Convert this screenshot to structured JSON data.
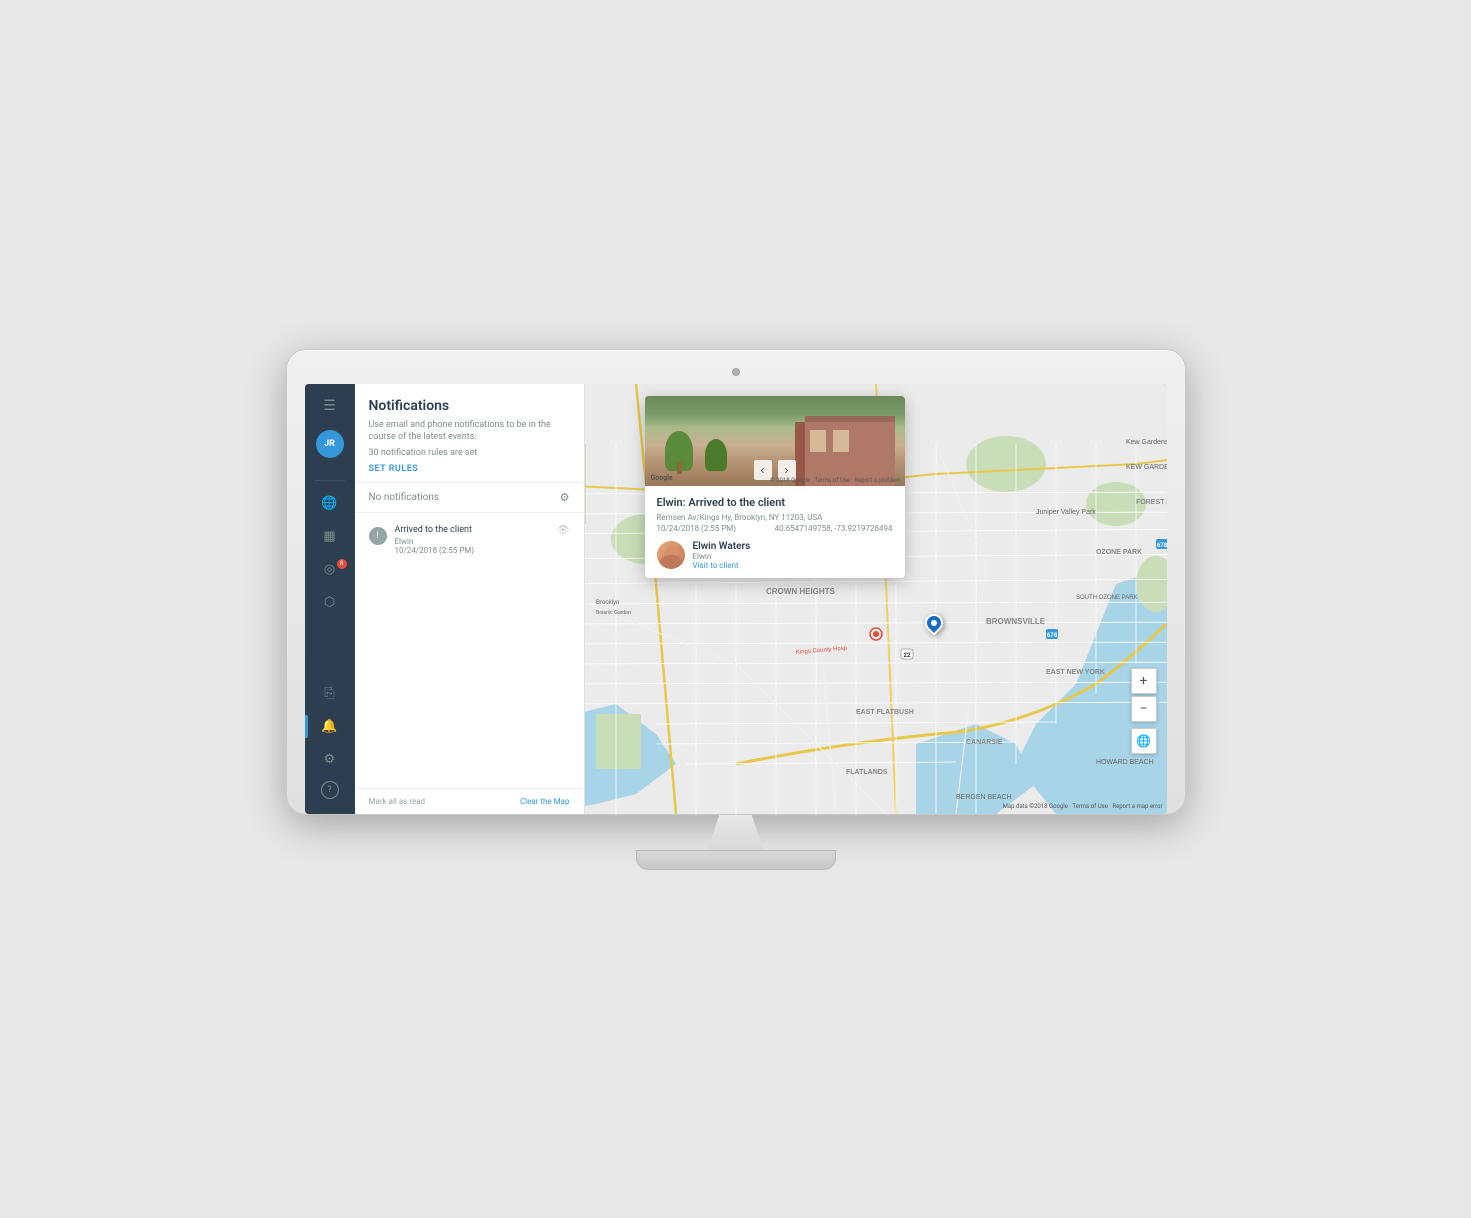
{
  "monitor": {
    "camera_label": "camera"
  },
  "sidebar": {
    "avatar_initials": "JR",
    "icons": [
      {
        "name": "menu-icon",
        "symbol": "☰",
        "active": false
      },
      {
        "name": "globe-icon",
        "symbol": "🌐",
        "active": false
      },
      {
        "name": "chart-icon",
        "symbol": "📊",
        "active": false
      },
      {
        "name": "location-icon",
        "symbol": "◉",
        "active": false,
        "badge": "8"
      },
      {
        "name": "car-icon",
        "symbol": "🚗",
        "active": false
      },
      {
        "name": "clipboard-icon",
        "symbol": "📋",
        "active": false
      },
      {
        "name": "bell-icon",
        "symbol": "🔔",
        "active": true
      },
      {
        "name": "settings-icon",
        "symbol": "⚙",
        "active": false
      },
      {
        "name": "help-icon",
        "symbol": "?",
        "active": false
      }
    ]
  },
  "notifications": {
    "panel_title": "Notifications",
    "description": "Use email and phone notifications to be in the course of the latest events.",
    "rules_count": "30 notification rules are set",
    "set_rules_label": "SET RULES",
    "list_header": "No notifications",
    "settings_tooltip": "Settings",
    "item": {
      "title": "Arrived to the client",
      "agent": "Elwin",
      "timestamp": "10/24/2018 (2:55 PM)"
    },
    "mark_read_label": "Mark all as read",
    "clear_map_label": "Clear the Map"
  },
  "popup": {
    "event_title": "Elwin: Arrived to the client",
    "address": "Remsen Av/Kings Hy, Brooklyn, NY 11203, USA",
    "datetime": "10/24/2018 (2:55 PM)",
    "coordinates": "40.6547149758, -73.9219728494",
    "agent_name": "Elwin Waters",
    "agent_sub": "Elwin",
    "visit_link": "Visit to client",
    "google_label": "Google",
    "copyright": "© 2018 Google",
    "terms": "Terms of Use",
    "report": "Report a problem"
  },
  "map": {
    "zoom_in": "+",
    "zoom_out": "−",
    "attribution": "Map data ©2018 Google · Terms of Use · Report a map error",
    "brooklyn_botanic": "Brooklyn Botanic Garden",
    "neighborhoods": [
      "CROWN HEIGHTS",
      "BROWNSVILLE",
      "EAST NEW YORK",
      "EAST FLATBUSH",
      "CANARSIE",
      "FLATLANDS",
      "BERGEN BEACH",
      "HOWARD BEACH",
      "OZONE PARK",
      "SOUTH OZONE PARK",
      "FOREST HILLS",
      "KEW GARDENS"
    ],
    "marker_location": "Remsen Av/Kings Hy"
  }
}
